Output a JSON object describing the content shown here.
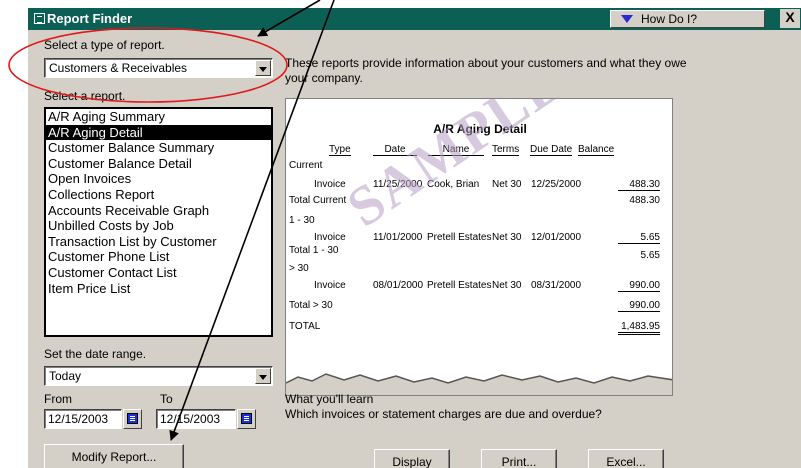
{
  "window": {
    "title": "Report Finder",
    "how_do_i": "How Do I?",
    "close": "X"
  },
  "report_type": {
    "label": "Select a type of report.",
    "value": "Customers & Receivables"
  },
  "report_list": {
    "label": "Select a report.",
    "items": [
      "A/R Aging Summary",
      "A/R Aging Detail",
      "Customer Balance Summary",
      "Customer Balance Detail",
      "Open Invoices",
      "Collections Report",
      "Accounts Receivable Graph",
      "Unbilled Costs by Job",
      "Transaction List by Customer",
      "Customer Phone List",
      "Customer Contact List",
      "Item Price List"
    ],
    "selected_index": 1
  },
  "description": "These reports provide information about your customers and what they owe your company.",
  "preview": {
    "title": "A/R Aging Detail",
    "headers": [
      "Type",
      "Date",
      "Name",
      "Terms",
      "Due Date",
      "Balance"
    ],
    "current": "Current",
    "row1": {
      "type": "Invoice",
      "date": "11/25/2000",
      "name": "Cook, Brian",
      "terms": "Net 30",
      "due": "12/25/2000",
      "balance": "488.30"
    },
    "total_current": "Total Current",
    "total_current_value": "488.30",
    "range_1_30": "1 - 30",
    "row2": {
      "type": "Invoice",
      "date": "11/01/2000",
      "name": "Pretell Estates",
      "terms": "Net 30",
      "due": "12/01/2000",
      "balance": "5.65"
    },
    "total_1_30": "Total 1 - 30",
    "total_1_30_value": "5.65",
    "range_over_30": "> 30",
    "row3": {
      "type": "Invoice",
      "date": "08/01/2000",
      "name": "Pretell Estates",
      "terms": "Net 30",
      "due": "08/31/2000",
      "balance": "990.00"
    },
    "total_over_30": "Total > 30",
    "total_over_30_value": "990.00",
    "total": "TOTAL",
    "total_value": "1,483.95",
    "watermark": "SAMPLE"
  },
  "learn": {
    "heading": "What you'll learn",
    "text": "Which invoices or statement charges are due and overdue?"
  },
  "date_range": {
    "label": "Set the date range.",
    "value": "Today",
    "from_label": "From",
    "to_label": "To",
    "from": "12/15/2003",
    "to": "12/15/2003"
  },
  "buttons": {
    "modify": "Modify Report...",
    "display": "Display",
    "print": "Print...",
    "excel": "Excel..."
  }
}
